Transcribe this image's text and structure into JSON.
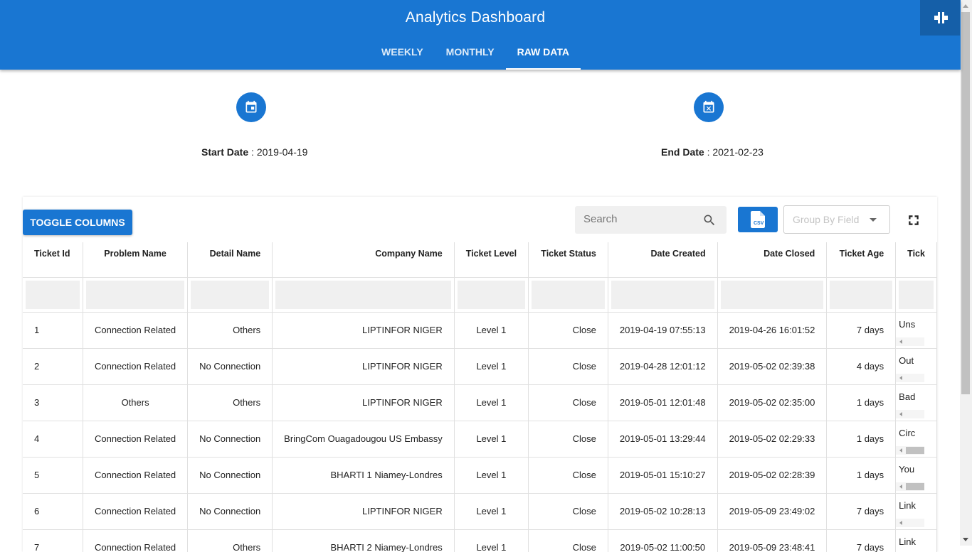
{
  "header": {
    "title": "Analytics Dashboard",
    "tabs": [
      {
        "label": "WEEKLY"
      },
      {
        "label": "MONTHLY"
      },
      {
        "label": "RAW DATA"
      }
    ],
    "active_tab": "RAW DATA",
    "exit_fullscreen_icon": "fullscreen-exit-icon"
  },
  "dates": {
    "start_label": "Start Date",
    "start_value": "2019-04-19",
    "end_label": "End Date",
    "end_value": "2021-02-23"
  },
  "toolbar": {
    "toggle_columns": "TOGGLE COLUMNS",
    "search_placeholder": "Search",
    "group_by_placeholder": "Group By Field",
    "csv_icon": "csv-file-icon",
    "fullscreen_icon": "fullscreen-icon"
  },
  "table": {
    "columns": [
      "Ticket Id",
      "Problem Name",
      "Detail Name",
      "Company Name",
      "Ticket Level",
      "Ticket Status",
      "Date Created",
      "Date Closed",
      "Ticket Age",
      "Tick"
    ],
    "rows": [
      [
        "1",
        "Connection Related",
        "Others",
        "LIPTINFOR NIGER",
        "Level 1",
        "Close",
        "2019-04-19 07:55:13",
        "2019-04-26 16:01:52",
        "7 days",
        "Uns"
      ],
      [
        "2",
        "Connection Related",
        "No Connection",
        "LIPTINFOR NIGER",
        "Level 1",
        "Close",
        "2019-04-28 12:01:12",
        "2019-05-02 02:39:38",
        "4 days",
        "Out"
      ],
      [
        "3",
        "Others",
        "Others",
        "LIPTINFOR NIGER",
        "Level 1",
        "Close",
        "2019-05-01 12:01:48",
        "2019-05-02 02:35:00",
        "1 days",
        "Bad"
      ],
      [
        "4",
        "Connection Related",
        "No Connection",
        "BringCom Ouagadougou US Embassy",
        "Level 1",
        "Close",
        "2019-05-01 13:29:44",
        "2019-05-02 02:29:33",
        "1 days",
        "Circ"
      ],
      [
        "5",
        "Connection Related",
        "No Connection",
        "BHARTI 1 Niamey-Londres",
        "Level 1",
        "Close",
        "2019-05-01 15:10:27",
        "2019-05-02 02:28:39",
        "1 days",
        "You"
      ],
      [
        "6",
        "Connection Related",
        "No Connection",
        "LIPTINFOR NIGER",
        "Level 1",
        "Close",
        "2019-05-02 10:28:13",
        "2019-05-09 23:49:02",
        "7 days",
        "Link"
      ],
      [
        "7",
        "Connection Related",
        "Others",
        "BHARTI 2 Niamey-Londres",
        "Level 1",
        "Close",
        "2019-05-02 11:00:50",
        "2019-05-09 23:48:41",
        "7 days",
        "Link"
      ]
    ]
  },
  "colors": {
    "primary": "#1976d2",
    "primary_dark": "#155fa8",
    "filter_bg": "#f0f0f0"
  }
}
